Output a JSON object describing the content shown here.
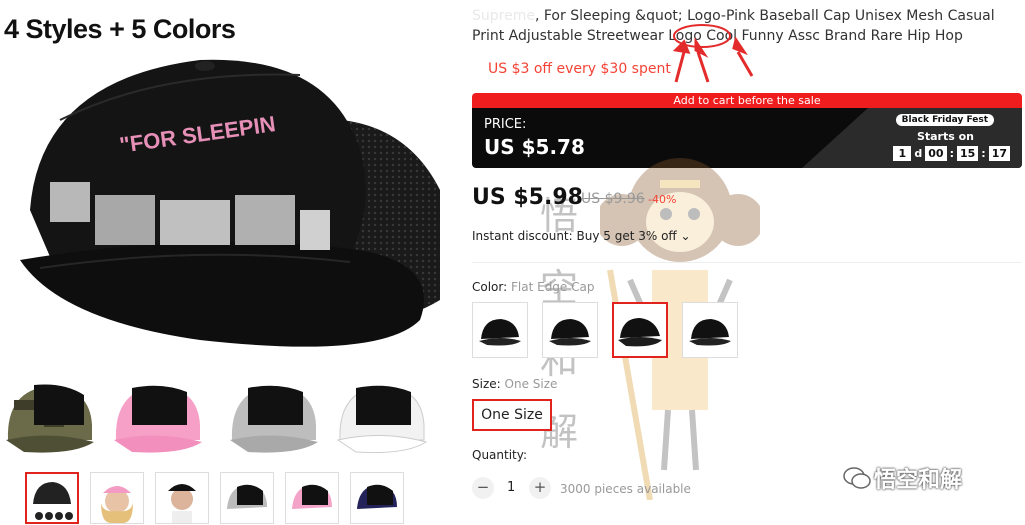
{
  "gallery": {
    "banner_text": "4 Styles + 5 Colors",
    "cap_print_text": "\"FOR SLEEPIN",
    "variants": [
      "camo-cap",
      "pink-cap",
      "grey-cap",
      "white-cap"
    ],
    "thumbnails": [
      "thumb-1",
      "thumb-2",
      "thumb-3",
      "thumb-4",
      "thumb-5",
      "thumb-6"
    ]
  },
  "product": {
    "title_prefix": "Supreme",
    "title": ", For Sleeping &quot; Logo-Pink Baseball Cap Unisex Mesh Casual Print Adjustable Streetwear Logo Cool Funny Assc Brand Rare Hip Hop",
    "coupon": "US $3 off every $30 spent"
  },
  "sale": {
    "bar_text": "Add to cart before the sale",
    "price_label": "PRICE:",
    "price": "US $5.78",
    "badge": "Black Friday Fest",
    "starts_on": "Starts on",
    "days": "1",
    "days_unit": "d",
    "hours": "00",
    "minutes": "15",
    "seconds": "17"
  },
  "pricing": {
    "current": "US $5.98",
    "original": "US $9.96",
    "discount": "-40%",
    "instant_discount": "Instant discount: Buy 5 get 3% off ⌄"
  },
  "color": {
    "label": "Color:",
    "value": "Flat Edge Cap"
  },
  "size": {
    "label": "Size:",
    "value": "One Size",
    "button": "One Size"
  },
  "quantity": {
    "label": "Quantity:",
    "minus": "−",
    "value": "1",
    "plus": "+",
    "available": "3000 pieces available"
  },
  "watermark": {
    "chars": "悟空和解",
    "brand": "悟空和解"
  },
  "colors": {
    "accent": "#e0231c",
    "sale_bar": "#ef1d1d",
    "pink_print": "#e690b8"
  }
}
